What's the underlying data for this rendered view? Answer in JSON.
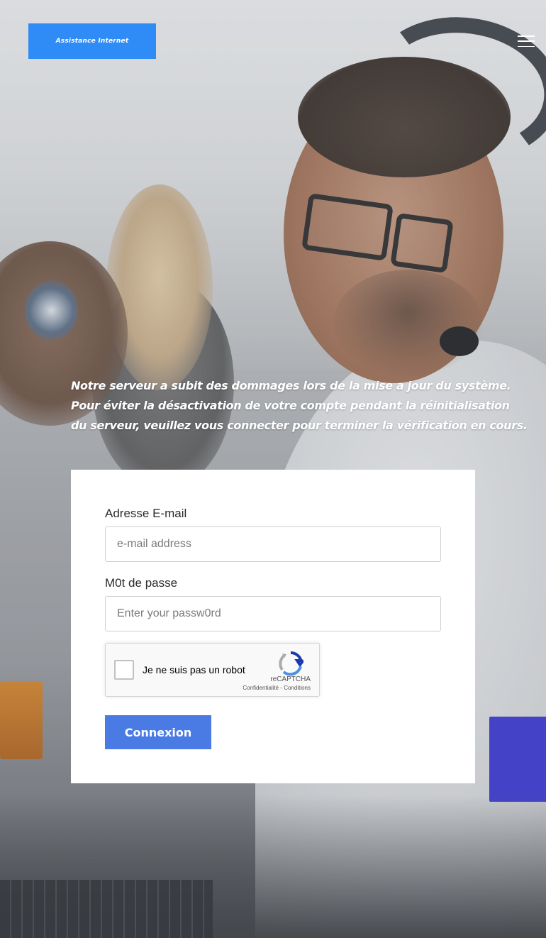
{
  "header": {
    "logo_text": "Assistance Internet",
    "menu_icon": "hamburger-menu-icon"
  },
  "message": {
    "line1": "Notre serveur a subit des dommages lors de la mise a jour du système.",
    "line2": "Pour éviter la désactivation de votre compte pendant la réinitialisation",
    "line3": "du serveur, veuillez vous connecter pour terminer la vérification en cours."
  },
  "form": {
    "email_label": "Adresse E-mail",
    "email_placeholder": "e-mail address",
    "email_value": "",
    "password_label": "M0t de passe",
    "password_placeholder": "Enter your passw0rd",
    "password_value": "",
    "submit_label": "Connexion"
  },
  "captcha": {
    "label": "Je ne suis pas un robot",
    "brand": "reCAPTCHA",
    "privacy": "Confidentialité",
    "separator": " - ",
    "terms": "Conditions",
    "checked": false,
    "icon": "recaptcha-logo-icon"
  },
  "colors": {
    "logo_bg": "#2f8bf6",
    "button_bg": "#4a7be4",
    "card_bg": "#ffffff"
  }
}
